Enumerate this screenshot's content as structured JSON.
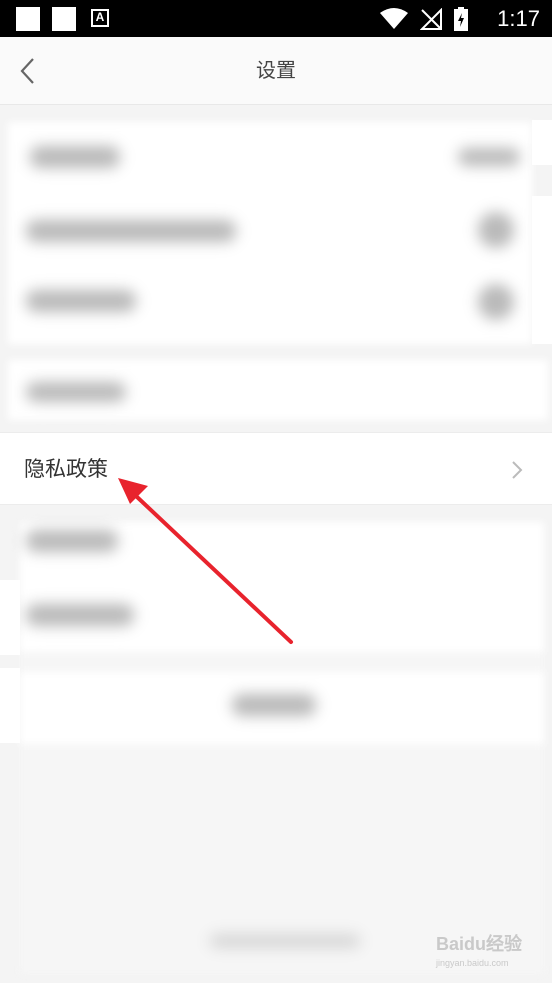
{
  "status_bar": {
    "time": "1:17"
  },
  "header": {
    "title": "设置",
    "back_icon": "chevron-left-icon"
  },
  "privacy_policy": {
    "label": "隐私政策",
    "chevron_icon": "chevron-right-icon"
  },
  "watermark": {
    "brand": "Baidu经验",
    "url": "jingyan.baidu.com"
  },
  "colors": {
    "annotation_arrow": "#e8232d",
    "status_bar": "#000000",
    "background": "#f4f4f4"
  }
}
